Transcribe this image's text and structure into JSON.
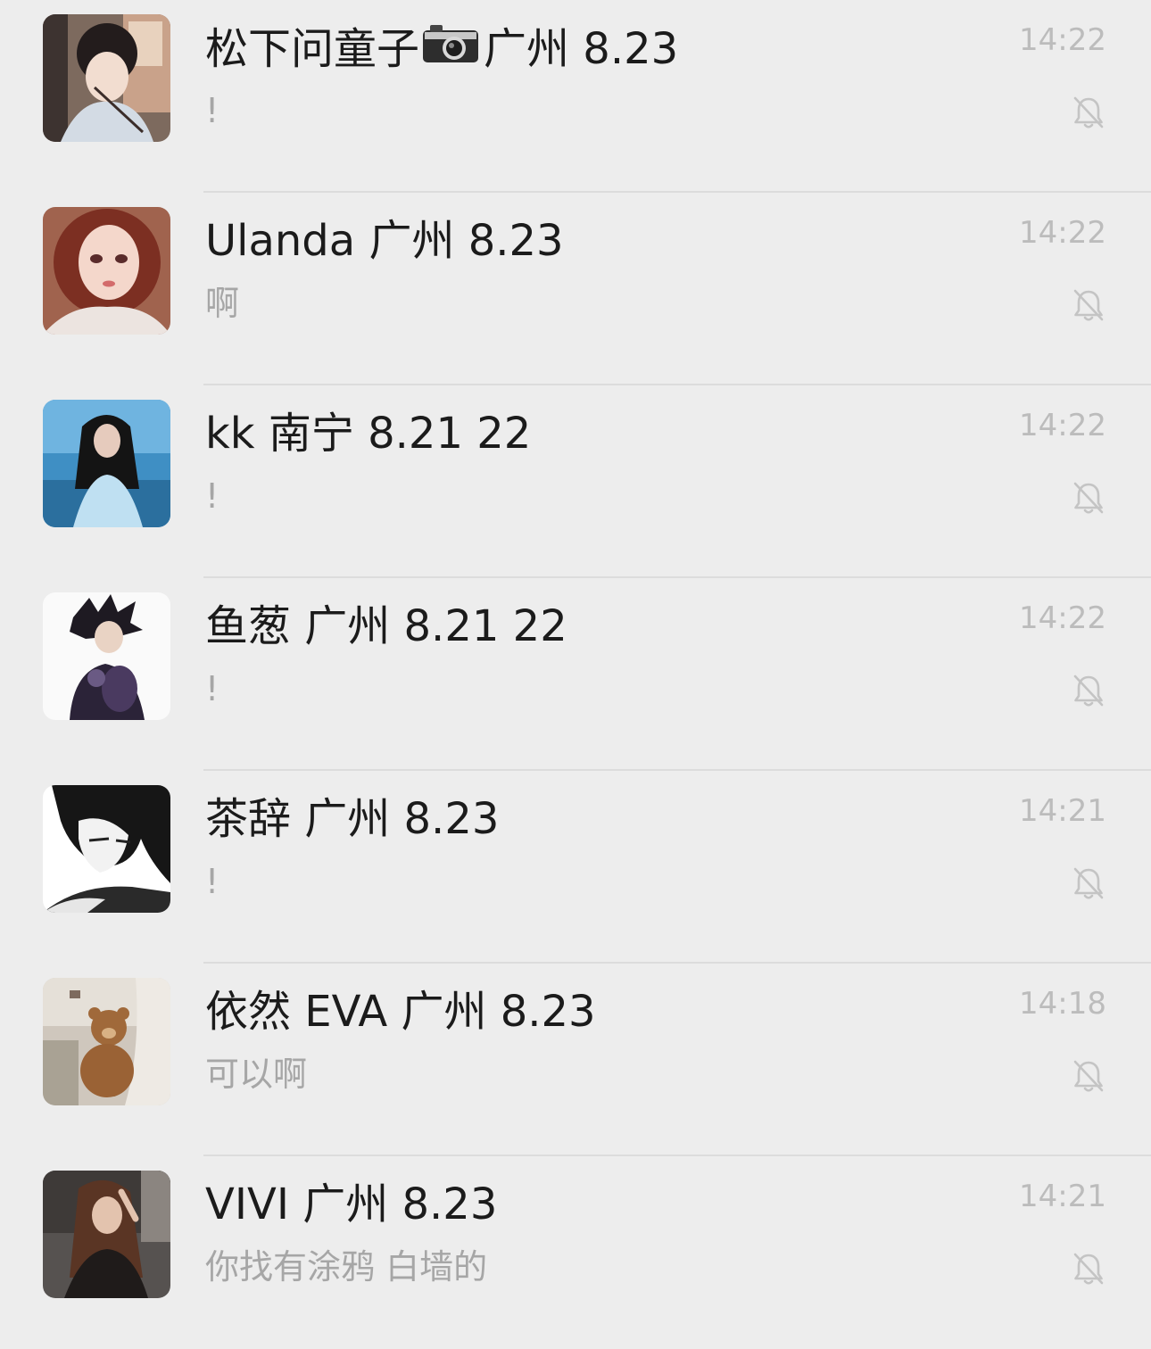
{
  "chats": [
    {
      "name": "松下问童子",
      "name_suffix": "广州 8.23",
      "name_emoji": "camera-emoji",
      "preview": "!",
      "time": "14:22",
      "muted": true
    },
    {
      "name": "Ulanda 广州 8.23",
      "preview": "啊",
      "time": "14:22",
      "muted": true
    },
    {
      "name": "kk 南宁 8.21 22",
      "preview": "!",
      "time": "14:22",
      "muted": true
    },
    {
      "name": "鱼葱 广州 8.21 22",
      "preview": "!",
      "time": "14:22",
      "muted": true
    },
    {
      "name": "茶辞 广州 8.23",
      "preview": "!",
      "time": "14:21",
      "muted": true
    },
    {
      "name": "依然 EVA 广州 8.23",
      "preview": "可以啊",
      "time": "14:18",
      "muted": true
    },
    {
      "name": "VIVI 广州 8.23",
      "preview": "你找有涂鸦 白墙的",
      "time": "14:21",
      "muted": true
    }
  ],
  "icons": {
    "mute": "bell-slash-icon"
  },
  "colors": {
    "background": "#ededed",
    "name_text": "#1b1b1b",
    "preview_text": "#a6a6a6",
    "time_text": "#bcbcbc",
    "icon": "#c4c4c4",
    "divider": "#dcdcdc"
  }
}
